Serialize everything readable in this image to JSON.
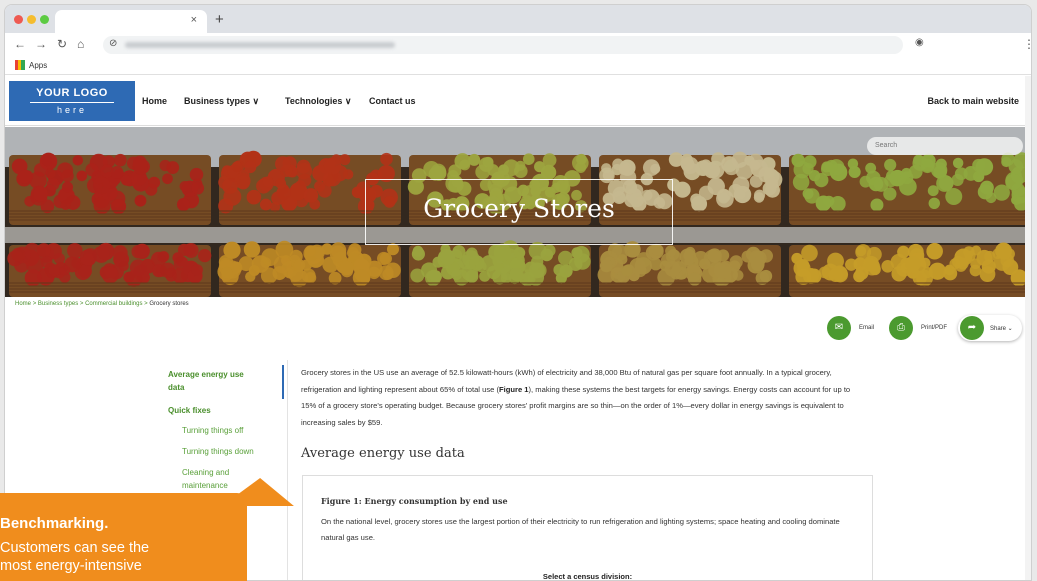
{
  "browser": {
    "tab_close": "×",
    "new_tab": "+",
    "bookmarks": {
      "apps_label": "Apps"
    }
  },
  "header": {
    "logo_line1": "YOUR LOGO",
    "logo_line2": "here",
    "nav": [
      {
        "label": "Home"
      },
      {
        "label": "Business types ∨"
      },
      {
        "label": "Technologies ∨"
      },
      {
        "label": "Contact us"
      }
    ],
    "back_link": "Back to main website"
  },
  "hero": {
    "title": "Grocery Stores",
    "search_placeholder": "Search"
  },
  "breadcrumb": {
    "items": [
      "Home",
      "Business types",
      "Commercial buildings"
    ],
    "separator": ">",
    "current": "Grocery stores"
  },
  "share": {
    "email_label": "Email",
    "print_label": "Print/PDF",
    "share_label": "Share ⌄"
  },
  "toc": {
    "main1_line1": "Average energy use",
    "main1_line2": "data",
    "main2": "Quick fixes",
    "sub1": "Turning things off",
    "sub2": "Turning things down",
    "sub3_line1": "Cleaning and",
    "sub3_line2": "maintenance"
  },
  "content": {
    "intro_a": "Grocery stores in the US use an average of 52.5 kilowatt-hours (kWh) of electricity and 38,000 Btu of natural gas per square foot annually. In a typical grocery, refrigeration and lighting represent about 65% of total use (",
    "intro_bold": "Figure 1",
    "intro_b": "), making these systems the best targets for energy savings. Energy costs can account for up to 15% of a grocery store's operating budget. Because grocery stores' profit margins are so thin—on the order of 1%—every dollar in energy savings is equivalent to increasing sales by $59.",
    "section_heading": "Average energy use data",
    "figure_title": "Figure 1: Energy consumption by end use",
    "figure_desc": "On the national level, grocery stores use the largest portion of their electricity to run refrigeration and lighting systems; space heating and cooling dominate natural gas use.",
    "census_label": "Select a census division:"
  },
  "callout": {
    "title": "Benchmarking.",
    "line1": "Customers can see the",
    "line2": "most energy-intensive"
  },
  "colors": {
    "accent_green": "#4b9a2f",
    "logo_blue": "#2e6ab4",
    "callout_orange": "#f08d1d"
  }
}
